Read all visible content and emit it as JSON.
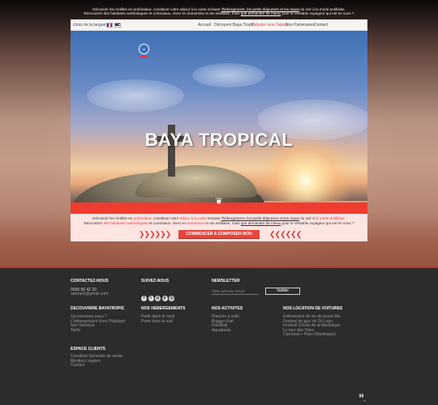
{
  "top_intro": {
    "line1_a": "Découvrir les Antilles en profondeur, constituer votre séjour à la carte incluant ",
    "line1_link": "l'hébergement, les petits déjeuners et les repas",
    "line1_b": " du soir à la mode antillaise.",
    "line2_a": "Rencontrer des habitants authentiques et conviviaux, vivez en immersion la vie antillaise, mais ",
    "line2_link": "que demander de mieux",
    "line2_b": " pour le véritable voyageur qui est en vous ?"
  },
  "nav": {
    "lang_label": "choix de la langue",
    "items": [
      {
        "label": "Accueil"
      },
      {
        "label": "Découvrir Baya Tropic"
      },
      {
        "label": "Débuter mon Séjour"
      },
      {
        "label": "Nos Partenaires"
      },
      {
        "label": "Contact"
      }
    ]
  },
  "hero": {
    "title": "BAYA TROPICAL",
    "scroll_icon": "chevron-down-icon"
  },
  "intro": {
    "l1_a": "Découvrir les Antilles en ",
    "l1_r1": "profondeur",
    "l1_b": ", constituer votre ",
    "l1_r2": "séjour à la carte",
    "l1_c": " incluant ",
    "l1_u": "l'hébergement, les petits déjeuners et les repas",
    "l1_d": " du soir à ",
    "l1_r3": "la mode antillaise.",
    "l2_a": "Rencontrer ",
    "l2_r1": "des habitants authentiques",
    "l2_b": " et conviviaux, vivez en ",
    "l2_r2": "immersion",
    "l2_c": " la vie antillaise, mais ",
    "l2_u": "que demander de mieux",
    "l2_d": " pour le véritable voyageur qui est en vous ?",
    "chevrons_left": "❯❯❯❯❯❯",
    "chevrons_right": "❮❮❮❮❮❮",
    "cta_label": "COMMENCER A COMPOSER MON SEJOUR"
  },
  "footer": {
    "contact": {
      "heading": "CONTACTEZ-NOUS",
      "phone": "0596 56 42 20",
      "email": "awimani@gmail.com"
    },
    "social": {
      "heading": "SUIVEZ-NOUS",
      "icons": [
        "facebook-icon",
        "twitter-icon",
        "google-plus-icon",
        "pinterest-icon",
        "instagram-icon"
      ]
    },
    "newsletter": {
      "heading": "NEWSLETTER",
      "placeholder": "Votre adresse email",
      "button": "Valider"
    },
    "discover": {
      "heading": "DECOUVRIRE BAYATROPIC",
      "items": [
        "Qui sommes-nous ?",
        "L'hébergement chez l'Habitant",
        "Nos Services",
        "Tarifs"
      ]
    },
    "lodging": {
      "heading": "NOS HEBERGEMENTS",
      "items": [
        "Partir dans le nord",
        "Partir dans le sud"
      ]
    },
    "activities": {
      "heading": "NOS ACTIVITES",
      "items": [
        "Planche à voile",
        "Buggys Kart",
        "Paintball",
        "Aquaboule"
      ]
    },
    "cars": {
      "heading": "NOS LOCATION DE VOITURES",
      "items": [
        "Enlèvement de vie de jeune fille",
        "Festival du jazz de St-Lucie",
        "Festival Créole de la Martinique",
        "Le tour des Yoles",
        "Carnaval + Pass (Martinique)"
      ]
    },
    "client": {
      "heading": "ESPACE CLIENTS",
      "items": [
        "Condition Générale de vente",
        "Mention Légales",
        "Contact"
      ]
    },
    "logo": "H",
    "logo_sub": "HL"
  },
  "colors": {
    "accent": "#e33a3a",
    "cta": "#e8453c",
    "footer_bg": "#2c2c2c"
  }
}
